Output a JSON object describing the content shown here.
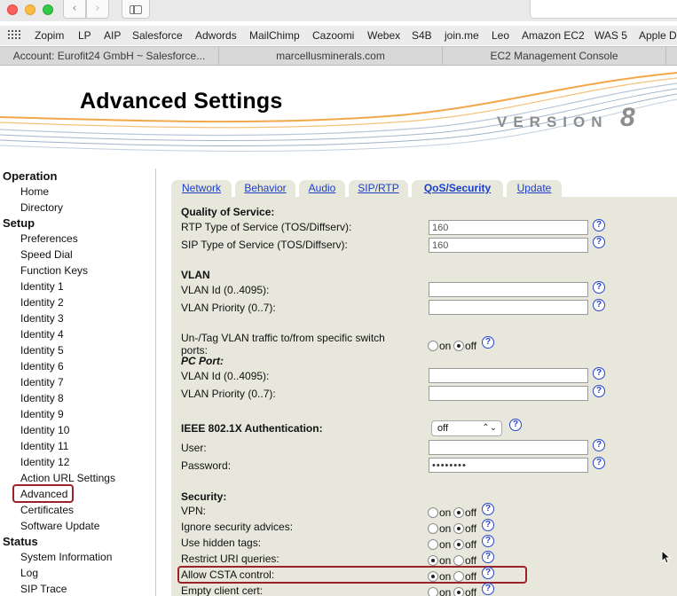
{
  "browser": {
    "bookmarks": [
      "Zopim",
      "LP",
      "AIP",
      "Salesforce",
      "Adwords",
      "MailChimp",
      "Cazoomi",
      "Webex",
      "S4B",
      "join.me",
      "Leo",
      "Amazon EC2",
      "WAS 5",
      "Apple De"
    ],
    "tabs": [
      "Account: Eurofit24 GmbH ~ Salesforce...",
      "marcellusminerals.com",
      "EC2 Management Console"
    ]
  },
  "header": {
    "title": "Advanced Settings",
    "version_word": "VERSION",
    "version_number": "8"
  },
  "sidebar": {
    "operation": {
      "heading": "Operation",
      "items": [
        "Home",
        "Directory"
      ]
    },
    "setup": {
      "heading": "Setup",
      "items": [
        "Preferences",
        "Speed Dial",
        "Function Keys",
        "Identity 1",
        "Identity 2",
        "Identity 3",
        "Identity 4",
        "Identity 5",
        "Identity 6",
        "Identity 7",
        "Identity 8",
        "Identity 9",
        "Identity 10",
        "Identity 11",
        "Identity 12",
        "Action URL Settings",
        "Advanced",
        "Certificates",
        "Software Update"
      ],
      "active": "Advanced"
    },
    "status": {
      "heading": "Status",
      "items": [
        "System Information",
        "Log",
        "SIP Trace"
      ]
    }
  },
  "content_tabs": [
    "Network",
    "Behavior",
    "Audio",
    "SIP/RTP",
    "QoS/Security",
    "Update"
  ],
  "active_tab": "QoS/Security",
  "qos": {
    "heading": "Quality of Service:",
    "rtp_label": "RTP Type of Service (TOS/Diffserv):",
    "rtp_value": "160",
    "sip_label": "SIP Type of Service (TOS/Diffserv):",
    "sip_value": "160"
  },
  "vlan": {
    "heading": "VLAN",
    "id_label": "VLAN Id (0..4095):",
    "id_value": "",
    "priority_label": "VLAN Priority (0..7):",
    "priority_value": "",
    "untag_label": "Un-/Tag VLAN traffic to/from specific switch ports:",
    "untag_value": "off",
    "pc_port_label": "PC Port:",
    "pc_id_label": "VLAN Id (0..4095):",
    "pc_id_value": "",
    "pc_priority_label": "VLAN Priority (0..7):",
    "pc_priority_value": ""
  },
  "ieee": {
    "heading": "IEEE 802.1X Authentication:",
    "selected": "off",
    "user_label": "User:",
    "user_value": "",
    "password_label": "Password:",
    "password_value": "••••••••"
  },
  "security": {
    "heading": "Security:",
    "on_label": "on",
    "off_label": "off",
    "help_symbol": "?",
    "rows": [
      {
        "label": "VPN:",
        "value": "off"
      },
      {
        "label": "Ignore security advices:",
        "value": "off"
      },
      {
        "label": "Use hidden tags:",
        "value": "off"
      },
      {
        "label": "Restrict URI queries:",
        "value": "on"
      },
      {
        "label": "Allow CSTA control:",
        "value": "on"
      },
      {
        "label": "Empty client cert:",
        "value": "on"
      }
    ]
  },
  "colors": {
    "link": "#1a3ec7",
    "highlight_border": "#9b2229",
    "panel_bg": "#e7e7dc"
  }
}
